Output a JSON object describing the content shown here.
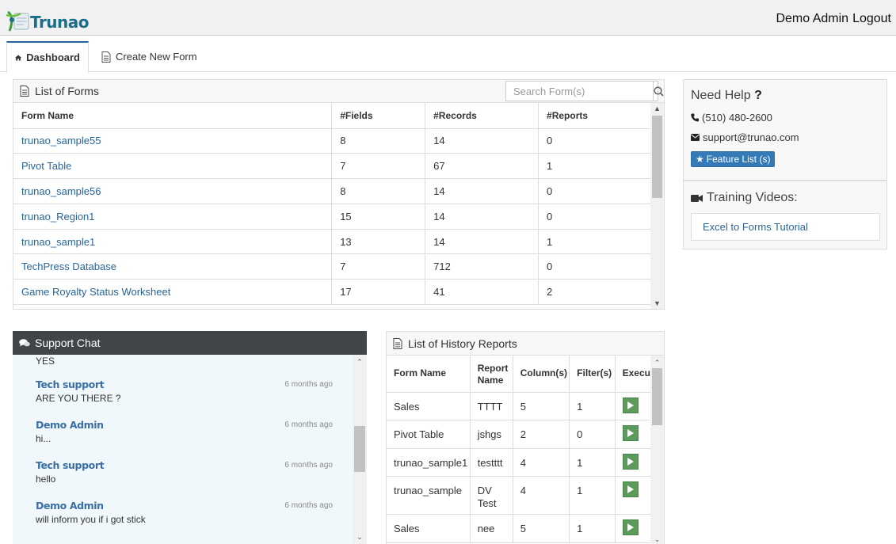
{
  "header": {
    "logo_text": "Trunao",
    "user_name": "Demo Admin",
    "logout_label": "Logout"
  },
  "tabs": [
    {
      "label": "Dashboard",
      "icon": "home-icon",
      "active": true
    },
    {
      "label": "Create New Form",
      "icon": "document-icon",
      "active": false
    }
  ],
  "forms_panel": {
    "title": "List of Forms",
    "search_placeholder": "Search Form(s)",
    "columns": [
      "Form Name",
      "#Fields",
      "#Records",
      "#Reports"
    ],
    "rows": [
      [
        "trunao_sample55",
        "8",
        "14",
        "0"
      ],
      [
        "Pivot Table",
        "7",
        "67",
        "1"
      ],
      [
        "trunao_sample56",
        "8",
        "14",
        "0"
      ],
      [
        "trunao_Region1",
        "15",
        "14",
        "0"
      ],
      [
        "trunao_sample1",
        "13",
        "14",
        "1"
      ],
      [
        "TechPress Database",
        "7",
        "712",
        "0"
      ],
      [
        "Game Royalty Status Worksheet",
        "17",
        "41",
        "2"
      ]
    ]
  },
  "help": {
    "title": "Need Help",
    "title_mark": "?",
    "phone": "(510) 480-2600",
    "email": "support@trunao.com",
    "feature_button": "Feature List (s)"
  },
  "videos": {
    "title": "Training Videos:",
    "items": [
      "Excel to Forms Tutorial"
    ]
  },
  "chat": {
    "title": "Support Chat",
    "partial_top_text": "YES",
    "messages": [
      {
        "who": "Tech support",
        "when": "6 months ago",
        "text": "ARE YOU THERE ?"
      },
      {
        "who": "Demo Admin",
        "when": "6 months ago",
        "text": "hi..."
      },
      {
        "who": "Tech support",
        "when": "6 months ago",
        "text": "hello"
      },
      {
        "who": "Demo Admin",
        "when": "6 months ago",
        "text": "will inform you if i got stick"
      }
    ]
  },
  "history": {
    "title": "List of History Reports",
    "columns": [
      "Form Name",
      "Report Name",
      "Column(s)",
      "Filter(s)",
      "Execu"
    ],
    "rows": [
      [
        "Sales",
        "TTTT",
        "5",
        "1"
      ],
      [
        "Pivot Table",
        "jshgs",
        "2",
        "0"
      ],
      [
        "trunao_sample1",
        "testttt",
        "4",
        "1"
      ],
      [
        "trunao_sample",
        "DV Test",
        "4",
        "1"
      ],
      [
        "Sales",
        "nee",
        "5",
        "1"
      ]
    ]
  },
  "colors": {
    "link": "#2a6496",
    "primary_button": "#337ab7",
    "chat_header": "#414448",
    "chat_bg": "#f1f8fc",
    "play_button": "#5c9a5c"
  }
}
